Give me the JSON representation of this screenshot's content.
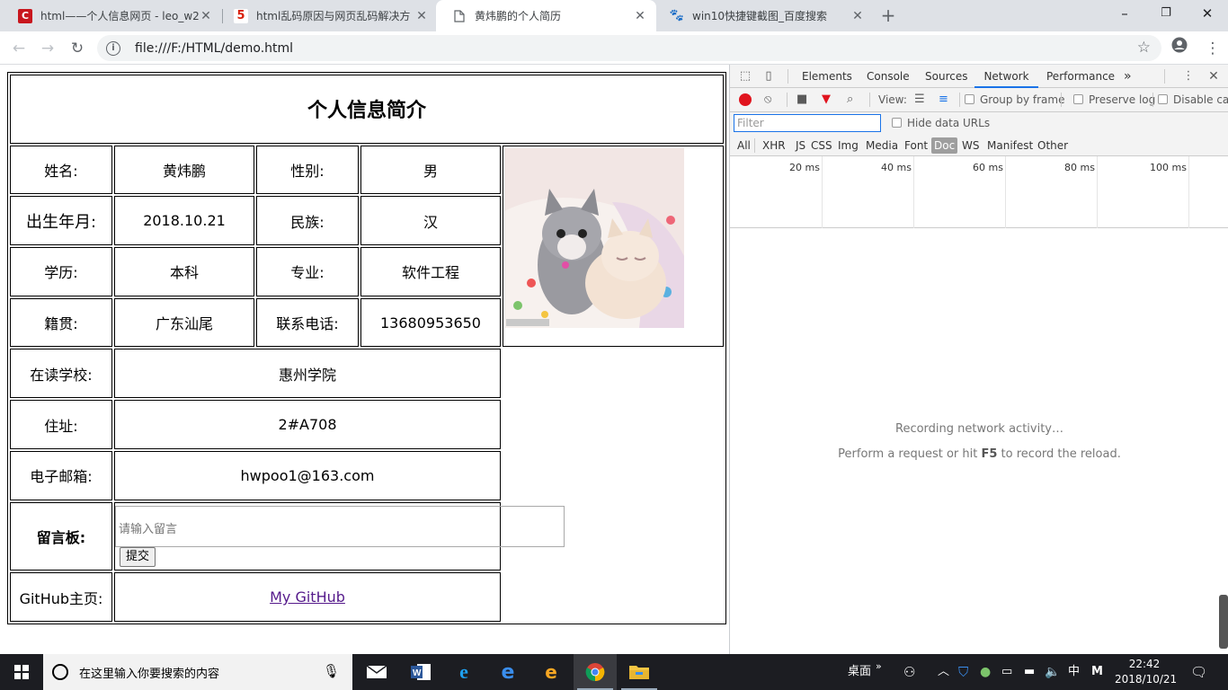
{
  "browser": {
    "tabs": [
      {
        "title": "html——个人信息网页 - leo_w2",
        "favicon": "csdn-icon"
      },
      {
        "title": "html乱码原因与网页乱码解决方",
        "favicon": "jb51-icon"
      },
      {
        "title": "黄炜鹏的个人简历",
        "favicon": "page-icon"
      },
      {
        "title": "win10快捷键截图_百度搜索",
        "favicon": "baidu-icon"
      }
    ],
    "url": "file:///F:/HTML/demo.html"
  },
  "resume": {
    "title": "个人信息简介",
    "name_label": "姓名:",
    "name": "黄炜鹏",
    "gender_label": "性别:",
    "gender": "男",
    "birth_label": "出生年月:",
    "birth": "2018.10.21",
    "ethnicity_label": "民族:",
    "ethnicity": "汉",
    "education_label": "学历:",
    "education": "本科",
    "major_label": "专业:",
    "major": "软件工程",
    "hometown_label": "籍贯:",
    "hometown": "广东汕尾",
    "phone_label": "联系电话:",
    "phone": "13680953650",
    "school_label": "在读学校:",
    "school": "惠州学院",
    "address_label": "住址:",
    "address": "2#A708",
    "email_label": "电子邮箱:",
    "email": "hwpoo1@163.com",
    "message_label": "留言板:",
    "message_placeholder": "请输入留言",
    "submit_label": "提交",
    "github_label": "GitHub主页:",
    "github_link": "My GitHub"
  },
  "devtools": {
    "tabs": [
      "Elements",
      "Console",
      "Sources",
      "Network",
      "Performance"
    ],
    "active_tab": "Network",
    "more": "»",
    "view_label": "View:",
    "group_by_frame": "Group by frame",
    "preserve_log": "Preserve log",
    "disable_cache": "Disable cac",
    "filter_placeholder": "Filter",
    "hide_data_urls": "Hide data URLs",
    "filter_types": [
      "All",
      "XHR",
      "JS",
      "CSS",
      "Img",
      "Media",
      "Font",
      "Doc",
      "WS",
      "Manifest",
      "Other"
    ],
    "active_filter": "Doc",
    "timeline_labels": [
      "20 ms",
      "40 ms",
      "60 ms",
      "80 ms",
      "100 ms"
    ],
    "recording_msg": "Recording network activity…",
    "hint_prefix": "Perform a request or hit ",
    "hint_key": "F5",
    "hint_suffix": " to record the reload."
  },
  "taskbar": {
    "search_placeholder": "在这里输入你要搜索的内容",
    "desktop_label": "桌面",
    "ime": "中",
    "ime2": "M",
    "time": "22:42",
    "date": "2018/10/21"
  },
  "colors": {
    "recording": "#e0141e",
    "accent": "#1a73e8",
    "link": "#551a8b"
  }
}
